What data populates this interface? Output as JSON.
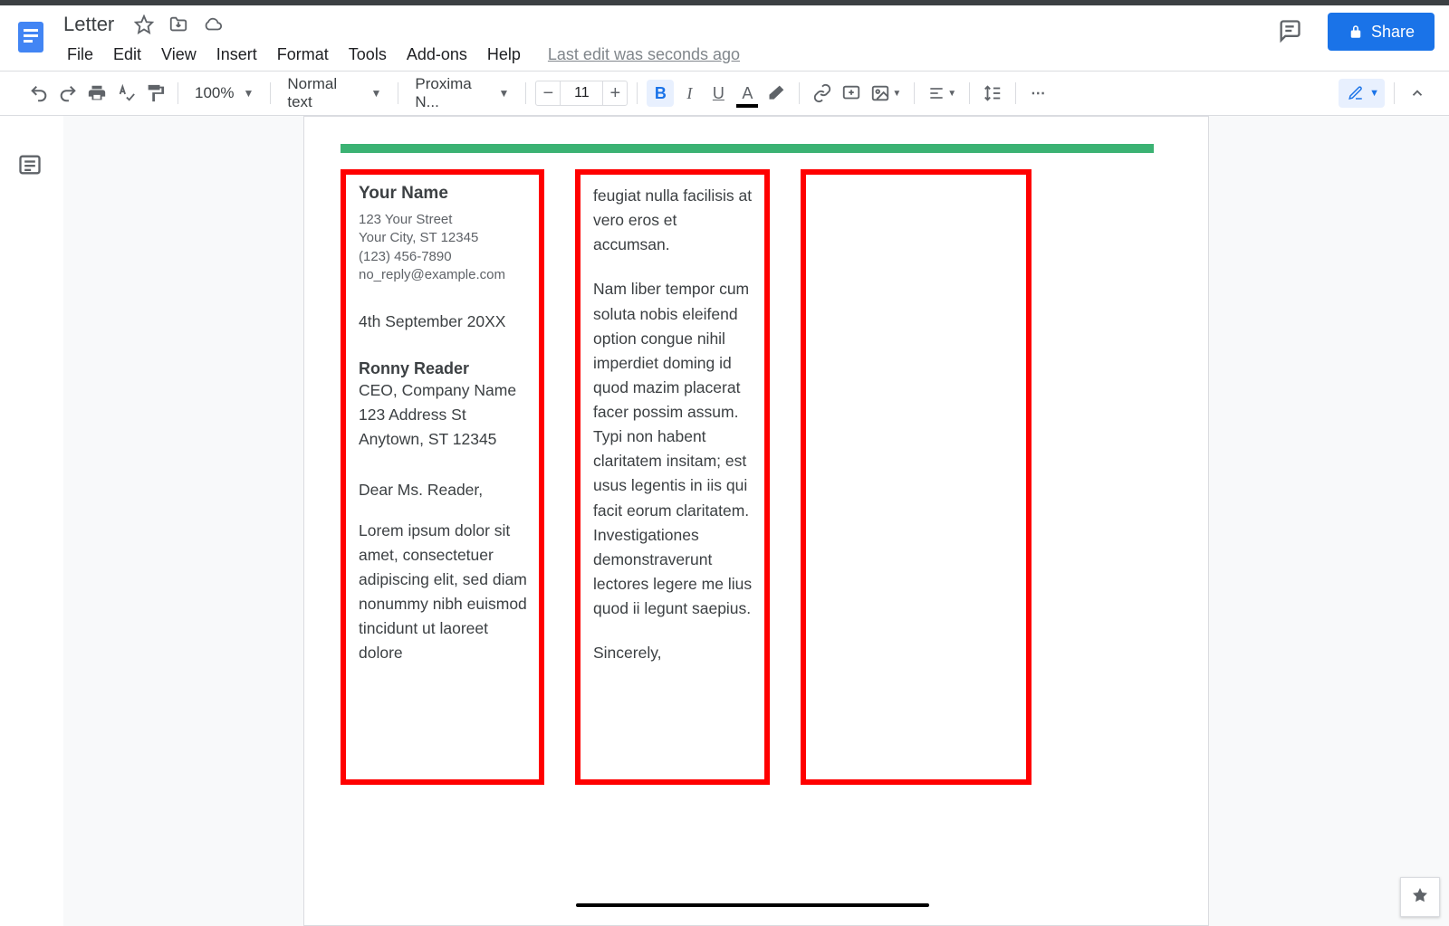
{
  "doc_title": "Letter",
  "menu": {
    "file": "File",
    "edit": "Edit",
    "view": "View",
    "insert": "Insert",
    "format": "Format",
    "tools": "Tools",
    "addons": "Add-ons",
    "help": "Help"
  },
  "last_edit": "Last edit was seconds ago",
  "share_label": "Share",
  "toolbar": {
    "zoom": "100%",
    "style": "Normal text",
    "font": "Proxima N...",
    "font_size": "11"
  },
  "document": {
    "sender": {
      "name": "Your Name",
      "street": "123 Your Street",
      "city": "Your City, ST 12345",
      "phone": "(123) 456-7890",
      "email": "no_reply@example.com"
    },
    "date": "4th September 20XX",
    "recipient": {
      "name": "Ronny Reader",
      "title": "CEO, Company Name",
      "street": "123 Address St",
      "city": "Anytown, ST 12345"
    },
    "salutation": "Dear Ms. Reader,",
    "para_col1": "Lorem ipsum dolor sit amet, consectetuer adipiscing elit, sed diam nonummy nibh euismod tincidunt ut laoreet dolore",
    "para_col2a": "feugiat nulla facilisis at vero eros et accumsan.",
    "para_col2b": "Nam liber tempor cum soluta nobis eleifend option congue nihil imperdiet doming id quod mazim placerat facer possim assum. Typi non habent claritatem insitam; est usus legentis in iis qui facit eorum claritatem. Investigationes demonstraverunt lectores legere me lius quod ii legunt saepius.",
    "closing": "Sincerely,"
  }
}
